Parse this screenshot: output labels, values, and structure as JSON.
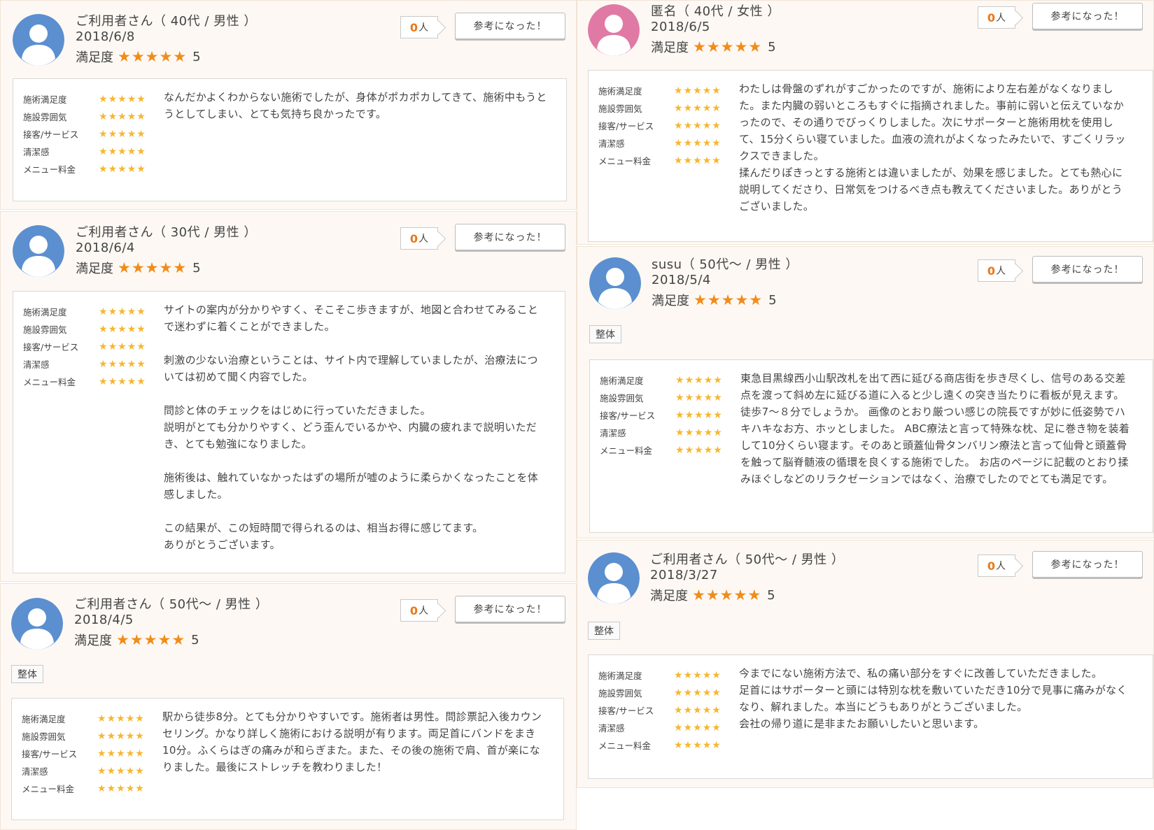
{
  "common": {
    "satisfaction_label": "満足度",
    "helpful_button": "参考になった！",
    "count_unit": "人",
    "rating_labels": [
      "施術満足度",
      "施設雰囲気",
      "接客/サービス",
      "清潔感",
      "メニュー料金"
    ]
  },
  "colors": {
    "accent_orange": "#f08c1a",
    "rating_star": "#f5b731",
    "avatar_blue": "#5b8fd0",
    "avatar_pink": "#e07aa5",
    "card_bg": "#fdf8f3"
  },
  "reviews": [
    {
      "name": "ご利用者さん（ 40代 / 男性 ）",
      "date": "2018/6/8",
      "score": "5",
      "count": "0",
      "tag": "",
      "avatar": "male-avatar-icon",
      "comment": "なんだかよくわからない施術でしたが、身体がポカポカしてきて、施術中もうとうとしてしまい、とても気持ち良かったです。"
    },
    {
      "name": "ご利用者さん（ 30代 / 男性 ）",
      "date": "2018/6/4",
      "score": "5",
      "count": "0",
      "tag": "",
      "avatar": "male-avatar-icon",
      "comment": "サイトの案内が分かりやすく、そこそこ歩きますが、地図と合わせてみることで迷わずに着くことができました。\n\n刺激の少ない治療ということは、サイト内で理解していましたが、治療法については初めて聞く内容でした。\n\n問診と体のチェックをはじめに行っていただきました。\n説明がとても分かりやすく、どう歪んでいるかや、内臓の疲れまで説明いただき、とても勉強になりました。\n\n施術後は、触れていなかったはずの場所が嘘のように柔らかくなったことを体感しました。\n\nこの結果が、この短時間で得られるのは、相当お得に感じてます。\nありがとうございます。"
    },
    {
      "name": "ご利用者さん（ 50代～ / 男性 ）",
      "date": "2018/4/5",
      "score": "5",
      "count": "0",
      "tag": "整体",
      "avatar": "male-avatar-icon",
      "comment": "駅から徒歩8分。とても分かりやすいです。施術者は男性。問診票記入後カウンセリング。かなり詳しく施術における説明が有ります。両足首にバンドをまき10分。ふくらはぎの痛みが和らぎまた。また、その後の施術で肩、首が楽になりました。最後にストレッチを教わりました！"
    },
    {
      "name": "匿名（ 40代 / 女性 ）",
      "date": "2018/6/5",
      "score": "5",
      "count": "0",
      "tag": "",
      "avatar": "female-avatar-icon",
      "comment": "わたしは骨盤のずれがすごかったのですが、施術により左右差がなくなりました。また内臓の弱いところもすぐに指摘されました。事前に弱いと伝えていなかったので、その通りでびっくりしました。次にサポーターと施術用枕を使用して、15分くらい寝ていました。血液の流れがよくなったみたいで、すごくリラックスできました。\n揉んだりぽきっとする施術とは違いましたが、効果を感じました。とても熱心に説明してくださり、日常気をつけるべき点も教えてくださいました。ありがとうございました。"
    },
    {
      "name": "susu（ 50代～ / 男性 ）",
      "date": "2018/5/4",
      "score": "5",
      "count": "0",
      "tag": "整体",
      "avatar": "male-avatar-icon",
      "comment": "東急目黒線西小山駅改札を出て西に延びる商店街を歩き尽くし、信号のある交差点を渡って斜め左に延びる道に入ると少し遠くの突き当たりに看板が見えます。徒歩7～８分でしょうか。 画像のとおり厳つい感じの院長ですが妙に低姿勢でハキハキなお方、ホッとしました。 ABC療法と言って特殊な枕、足に巻き物を装着して10分くらい寝ます。そのあと頭蓋仙骨タンバリン療法と言って仙骨と頭蓋骨を触って脳脊髄液の循環を良くする施術でした。 お店のページに記載のとおり揉みほぐしなどのリラクゼーションではなく、治療でしたのでとても満足です。"
    },
    {
      "name": "ご利用者さん（ 50代～ / 男性 ）",
      "date": "2018/3/27",
      "score": "5",
      "count": "0",
      "tag": "整体",
      "avatar": "male-avatar-icon",
      "comment": "今までにない施術方法で、私の痛い部分をすぐに改善していただきました。\n足首にはサポーターと頭には特別な枕を敷いていただき10分で見事に痛みがなくなり、解れました。本当にどうもありがとうございました。\n会社の帰り道に是非またお願いしたいと思います。"
    }
  ]
}
